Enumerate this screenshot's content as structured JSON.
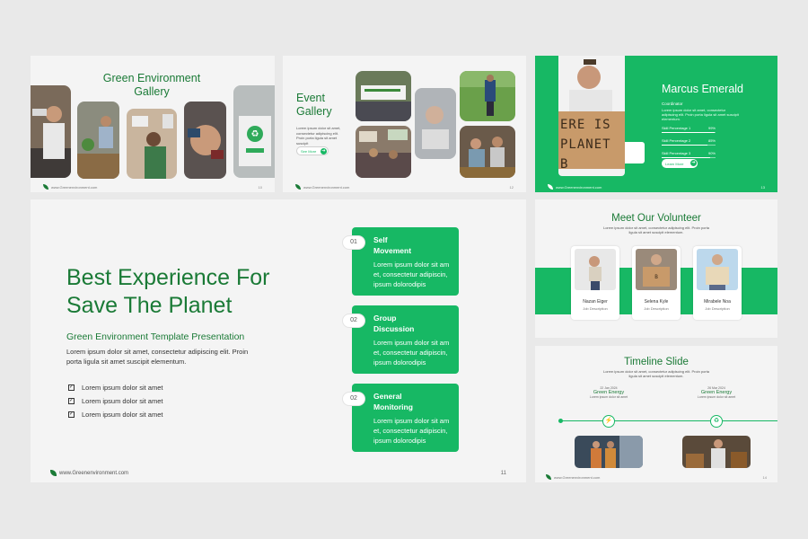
{
  "gallery_slide": {
    "title_line1": "Green Environment",
    "title_line2": "Gallery",
    "footer": "www.Greenenvironment.com",
    "page": "10"
  },
  "event_slide": {
    "title_line1": "Event",
    "title_line2": "Gallery",
    "description": "Lorem ipsum dolor sit amet, consectetur adipiscing elit. Proin porta ligula sit amet suscipit",
    "button_label": "See More",
    "footer": "www.Greenenvironment.com",
    "page": "12"
  },
  "profile_slide": {
    "name": "Marcus Emerald",
    "role": "Coordinator",
    "description": "Lorem ipsum dolor sit amet, consectetur adipiscing elit. Proin porta ligula sit amet suscipit elementum.",
    "sign_text": "ERE IS PLANET B",
    "skills": [
      {
        "label": "Skill Percentage 1",
        "value": "99%",
        "percent": 99
      },
      {
        "label": "Skill Percentage 2",
        "value": "85%",
        "percent": 85
      },
      {
        "label": "Skill Percentage 3",
        "value": "90%",
        "percent": 90
      }
    ],
    "button_label": "Learn More",
    "footer": "www.Greenenvironment.com",
    "page": "13"
  },
  "main_slide": {
    "headline_line1": "Best Experience For",
    "headline_line2": "Save The Planet",
    "subtitle": "Green Environment Template Presentation",
    "paragraph": "Lorem ipsum dolor sit amet, consectetur adipiscing elit. Proin porta ligula sit amet suscipit elementum.",
    "checklist": [
      "Lorem ipsum dolor sit amet",
      "Lorem ipsum dolor sit amet",
      "Lorem ipsum dolor sit amet"
    ],
    "cards": [
      {
        "num": "01",
        "title_line1": "Self",
        "title_line2": "Movement",
        "desc_line1": "Lorem ipsum dolor sit am",
        "desc_line2": "et, consectetur adipiscin,",
        "desc_line3": "ipsum dolorodipis"
      },
      {
        "num": "02",
        "title_line1": "Group",
        "title_line2": "Discussion",
        "desc_line1": "Lorem ipsum dolor sit am",
        "desc_line2": "et, consectetur adipiscin,",
        "desc_line3": "ipsum dolorodipis"
      },
      {
        "num": "02",
        "title_line1": "General",
        "title_line2": "Monitoring",
        "desc_line1": "Lorem ipsum dolor sit am",
        "desc_line2": "et, consectetur adipiscin,",
        "desc_line3": "ipsum dolorodipis"
      }
    ],
    "footer": "www.Greenenvironment.com",
    "page": "11"
  },
  "volunteer_slide": {
    "title": "Meet Our Volunteer",
    "description": "Lorem ipsum dolor sit amet, consectetur adipiscing elit. Proin porta ligula sit amet suscipit elementum.",
    "volunteers": [
      {
        "name": "Nazan Eiger",
        "role": "Job Description"
      },
      {
        "name": "Selena Kyle",
        "role": "Job Description"
      },
      {
        "name": "Mirabele Noa",
        "role": "Job Description"
      }
    ]
  },
  "timeline_slide": {
    "title": "Timeline Slide",
    "description": "Lorem ipsum dolor sit amet, consectetur adipiscing elit. Proin porta ligula sit amet suscipit elementum.",
    "events": [
      {
        "date": "22 Jan 2024",
        "title": "Green Energy",
        "desc": "Lorem ipsum dolor sit amet"
      },
      {
        "date": "26 Mar 2024",
        "title": "Green Energy",
        "desc": "Lorem ipsum dolor sit amet"
      }
    ],
    "footer": "www.Greenenvironment.com",
    "page": "14"
  },
  "colors": {
    "primary_green": "#17b864",
    "dark_green": "#1a7a36",
    "slide_bg": "#f4f4f4",
    "page_bg": "#e9e9e9"
  }
}
